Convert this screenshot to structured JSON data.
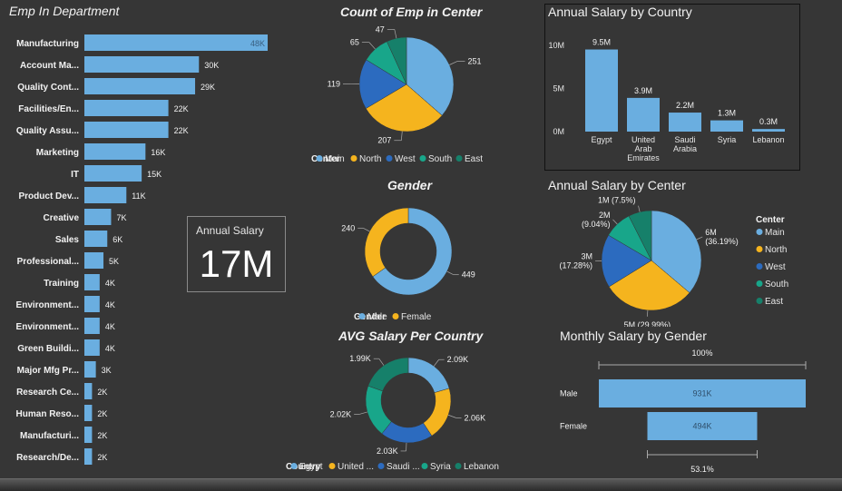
{
  "titles": {
    "emp_dept": "Emp In Department",
    "count_center": "Count of Emp in Center",
    "salary_country": "Annual Salary by Country",
    "gender": "Gender",
    "salary_center": "Annual Salary by Center",
    "avg_salary_country": "AVG Salary Per Country",
    "monthly_gender": "Monthly Salary by Gender"
  },
  "kpi": {
    "label": "Annual Salary",
    "value": "17M"
  },
  "colors": {
    "blue": "#6aaee0",
    "yellow": "#f5b41e",
    "darkblue": "#2c6bbf",
    "teal": "#18a68a",
    "darkteal": "#16806a",
    "background": "#363636"
  },
  "chart_data": [
    {
      "id": "emp_dept",
      "type": "bar",
      "orientation": "horizontal",
      "categories": [
        "Manufacturing",
        "Account Ma...",
        "Quality Cont...",
        "Facilities/En...",
        "Quality Assu...",
        "Marketing",
        "IT",
        "Product Dev...",
        "Creative",
        "Sales",
        "Professional...",
        "Training",
        "Environment...",
        "Environment...",
        "Green Buildi...",
        "Major Mfg Pr...",
        "Research Ce...",
        "Human Reso...",
        "Manufacturi...",
        "Research/De..."
      ],
      "values": [
        48000,
        30000,
        29000,
        22000,
        22000,
        16000,
        15000,
        11000,
        7000,
        6000,
        5000,
        4000,
        4000,
        4000,
        4000,
        3000,
        2000,
        2000,
        2000,
        2000
      ],
      "labels": [
        "48K",
        "30K",
        "29K",
        "22K",
        "22K",
        "16K",
        "15K",
        "11K",
        "7K",
        "6K",
        "5K",
        "4K",
        "4K",
        "4K",
        "4K",
        "3K",
        "2K",
        "2K",
        "2K",
        "2K"
      ]
    },
    {
      "id": "count_center",
      "type": "pie",
      "legend_title": "Center",
      "categories": [
        "Main",
        "North",
        "West",
        "South",
        "East"
      ],
      "values": [
        251,
        207,
        119,
        65,
        47
      ],
      "labels": [
        "251",
        "207",
        "119",
        "65",
        "47"
      ],
      "colors": [
        "#6aaee0",
        "#f5b41e",
        "#2c6bbf",
        "#18a68a",
        "#16806a"
      ]
    },
    {
      "id": "salary_country",
      "type": "bar",
      "categories": [
        "Egypt",
        "United Arab Emirates",
        "Saudi Arabia",
        "Syria",
        "Lebanon"
      ],
      "values": [
        9.5,
        3.9,
        2.2,
        1.3,
        0.3
      ],
      "labels": [
        "9.5M",
        "3.9M",
        "2.2M",
        "1.3M",
        "0.3M"
      ],
      "yticks": [
        "0M",
        "5M",
        "10M"
      ],
      "ylim": [
        0,
        10.5
      ]
    },
    {
      "id": "gender",
      "type": "pie",
      "donut": true,
      "legend_title": "Gender",
      "categories": [
        "Male",
        "Female"
      ],
      "values": [
        449,
        240
      ],
      "labels": [
        "449",
        "240"
      ],
      "colors": [
        "#6aaee0",
        "#f5b41e"
      ]
    },
    {
      "id": "salary_center",
      "type": "pie",
      "legend_title": "Center",
      "categories": [
        "Main",
        "North",
        "West",
        "South",
        "East"
      ],
      "values": [
        36.19,
        29.99,
        17.28,
        9.04,
        7.5
      ],
      "labels": [
        "6M (36.19%)",
        "5M (29.99%)",
        "3M (17.28%)",
        "2M (9.04%)",
        "1M (7.5%)"
      ],
      "colors": [
        "#6aaee0",
        "#f5b41e",
        "#2c6bbf",
        "#18a68a",
        "#16806a"
      ]
    },
    {
      "id": "avg_salary_country",
      "type": "pie",
      "donut": true,
      "legend_title": "Country",
      "categories": [
        "Egypt",
        "United ...",
        "Saudi ...",
        "Syria",
        "Lebanon"
      ],
      "values": [
        2.09,
        2.06,
        2.03,
        2.02,
        1.99
      ],
      "labels": [
        "2.09K",
        "2.06K",
        "2.03K",
        "2.02K",
        "1.99K"
      ],
      "colors": [
        "#6aaee0",
        "#f5b41e",
        "#2c6bbf",
        "#18a68a",
        "#16806a"
      ]
    },
    {
      "id": "monthly_gender",
      "type": "bar",
      "subtype": "funnel",
      "categories": [
        "Male",
        "Female"
      ],
      "values": [
        931000,
        494000
      ],
      "labels": [
        "931K",
        "494K"
      ],
      "top_percent": "100%",
      "bottom_percent": "53.1%"
    }
  ]
}
